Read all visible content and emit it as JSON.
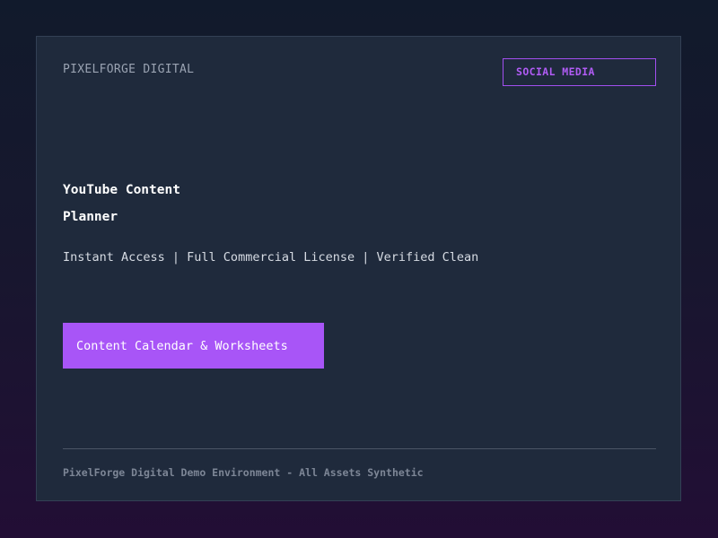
{
  "brand": {
    "name": "PIXELFORGE DIGITAL"
  },
  "badge": {
    "label": "SOCIAL MEDIA"
  },
  "product": {
    "title_line1": "YouTube Content",
    "title_line2": "Planner",
    "features": "Instant Access | Full Commercial License | Verified Clean"
  },
  "cta": {
    "label": "Content Calendar & Worksheets"
  },
  "footer": {
    "text": "PixelForge Digital Demo Environment - All Assets Synthetic"
  },
  "colors": {
    "accent": "#a855f7",
    "card_background": "#1f2a3c",
    "page_background_top": "#111a2c",
    "page_background_bottom": "#220e35"
  }
}
